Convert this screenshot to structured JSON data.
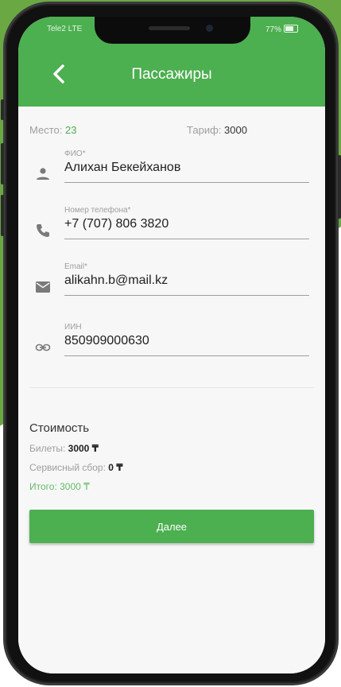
{
  "status": {
    "carrier": "Tele2 LTE",
    "battery": "77%"
  },
  "header": {
    "title": "Пассажиры"
  },
  "seat": {
    "place_label": "Место:",
    "place_value": "23",
    "tariff_label": "Тариф:",
    "tariff_value": "3000"
  },
  "form": {
    "fio": {
      "label": "ФИО*",
      "value": "Алихан Бекейханов"
    },
    "phone": {
      "label": "Номер телефона*",
      "value": "+7 (707) 806 3820"
    },
    "email": {
      "label": "Email*",
      "value": "alikahn.b@mail.kz"
    },
    "iin": {
      "label": "ИИН",
      "value": "850909000630"
    }
  },
  "cost": {
    "title": "Стоимость",
    "tickets_label": "Билеты:",
    "tickets_value": "3000 ₸",
    "service_label": "Сервисный сбор:",
    "service_value": "0 ₸",
    "total_label": "Итого:",
    "total_value": "3000 ₸"
  },
  "actions": {
    "next_label": "Далее"
  },
  "colors": {
    "accent": "#4caf50",
    "background_green": "#6aa844"
  }
}
